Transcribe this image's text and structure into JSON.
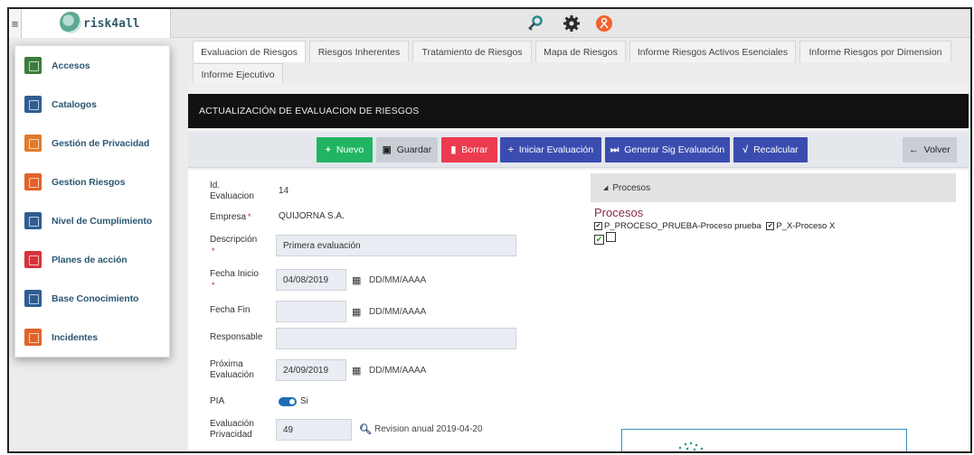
{
  "app": {
    "brand": "risk4all",
    "menu_icon": "≡"
  },
  "top_icons": [
    "key-icon",
    "gear-icon",
    "user-icon"
  ],
  "sidebar": {
    "items": [
      {
        "label": "Accesos",
        "icon": "access-icon",
        "color": "#3a7d3c"
      },
      {
        "label": "Catalogos",
        "icon": "catalog-icon",
        "color": "#2f5d92"
      },
      {
        "label": "Gestión de Privacidad",
        "icon": "privacy-icon",
        "color": "#e27a2b"
      },
      {
        "label": "Gestion Riesgos",
        "icon": "risk-icon",
        "color": "#e2622b"
      },
      {
        "label": "Nivel de Cumplimiento",
        "icon": "compliance-icon",
        "color": "#2f5d92"
      },
      {
        "label": "Planes de acción",
        "icon": "plans-icon",
        "color": "#d8323b"
      },
      {
        "label": "Base Conocimiento",
        "icon": "knowledge-icon",
        "color": "#2f5d92"
      },
      {
        "label": "Incidentes",
        "icon": "incidents-icon",
        "color": "#e2622b"
      }
    ]
  },
  "tabs": [
    {
      "label": "Evaluacion de Riesgos",
      "active": true
    },
    {
      "label": "Riesgos Inherentes"
    },
    {
      "label": "Tratamiento de Riesgos"
    },
    {
      "label": "Mapa de Riesgos"
    },
    {
      "label": "Informe Riesgos Activos Esenciales"
    },
    {
      "label": "Informe Riesgos por Dimension"
    },
    {
      "label": "Informe Ejecutivo"
    }
  ],
  "header": {
    "title": "ACTUALIZACIÓN DE EVALUACION DE RIESGOS"
  },
  "toolbar": {
    "nuevo": "Nuevo",
    "guardar": "Guardar",
    "borrar": "Borrar",
    "iniciar": "Iniciar Evaluación",
    "generar": "Generar Sig Evaluación",
    "recalcular": "Recalcular",
    "volver": "Volver",
    "colors": {
      "green": "#21b563",
      "gray": "#c9ced6",
      "red": "#ec3b4e",
      "blue": "#3b4cb0"
    }
  },
  "form": {
    "id_label": "Id.\nEvaluacion",
    "id_value": "14",
    "empresa_label": "Empresa",
    "empresa_value": "QUIJORNA S.A.",
    "descripcion_label": "Descripción",
    "descripcion_value": "Primera evaluación",
    "fecha_inicio_label": "Fecha Inicio",
    "fecha_inicio_value": "04/08/2019",
    "fecha_fin_label": "Fecha Fin",
    "fecha_fin_value": "",
    "date_format": "DD/MM/AAAA",
    "responsable_label": "Responsable",
    "responsable_value": "",
    "proxima_label": "Próxima\nEvaluación",
    "proxima_value": "24/09/2019",
    "pia_label": "PIA",
    "pia_value": "Si",
    "eval_priv_label": "Evaluación\nPrivacidad",
    "eval_priv_value": "49",
    "revision_text": "Revision anual 2019-04-20",
    "required_mark": "*"
  },
  "procesos": {
    "panel_label": "Procesos",
    "title": "Procesos",
    "items": [
      "P_PROCESO_PRUEBA-Proceso prueba",
      "P_X-Proceso X"
    ]
  }
}
